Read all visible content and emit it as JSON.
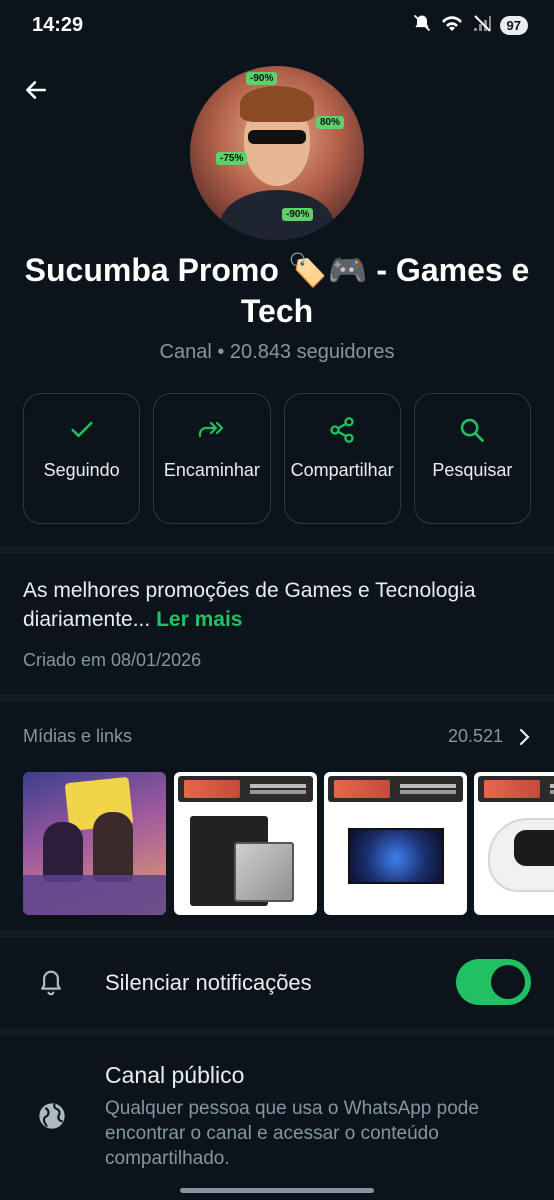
{
  "status_bar": {
    "time": "14:29",
    "battery": "97"
  },
  "channel": {
    "name": "Sucumba Promo 🏷️🎮  - Games e Tech",
    "subtitle": "Canal • 20.843 seguidores",
    "avatar_tags": [
      "-90%",
      "80%",
      "-75%",
      "-90%"
    ]
  },
  "actions": [
    {
      "label": "Seguindo",
      "icon": "check-icon"
    },
    {
      "label": "Encaminhar",
      "icon": "forward-icon"
    },
    {
      "label": "Compartilhar",
      "icon": "share-icon"
    },
    {
      "label": "Pesquisar",
      "icon": "search-icon"
    }
  ],
  "description": {
    "text": "As melhores promoções de Games e Tecnologia diariamente...",
    "read_more": "Ler mais",
    "created": "Criado em 08/01/2026"
  },
  "media": {
    "title": "Mídias e links",
    "count": "20.521",
    "thumbnails": [
      "gta-promo",
      "amd-ryzen-promo",
      "tv-promo",
      "ps5-controller-promo"
    ]
  },
  "mute": {
    "label": "Silenciar notificações",
    "enabled": true
  },
  "public_channel": {
    "title": "Canal público",
    "description": "Qualquer pessoa que usa o WhatsApp pode encontrar o canal e acessar o conteúdo compartilhado."
  },
  "colors": {
    "background": "#0b141a",
    "accent": "#21c063",
    "muted_text": "#8696a0"
  }
}
